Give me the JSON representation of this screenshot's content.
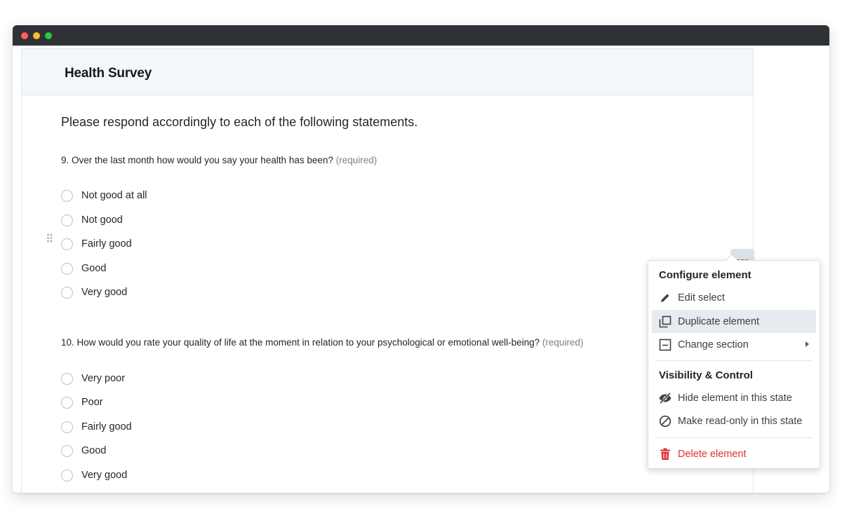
{
  "form": {
    "title": "Health Survey",
    "intro": "Please respond accordingly to each of the following statements."
  },
  "questions": [
    {
      "text": "9. Over the last month how would you say your health has been?",
      "required": "(required)",
      "options": [
        "Not good at all",
        "Not good",
        "Fairly good",
        "Good",
        "Very good"
      ]
    },
    {
      "text": "10. How would you rate your quality of life at the moment in relation to your psychological or emotional well-being?",
      "required": "(required)",
      "options": [
        "Very poor",
        "Poor",
        "Fairly good",
        "Good",
        "Very good"
      ]
    }
  ],
  "menu": {
    "configure_heading": "Configure element",
    "edit_select": "Edit select",
    "duplicate_element": "Duplicate element",
    "change_section": "Change section",
    "visibility_heading": "Visibility & Control",
    "hide_element": "Hide element in this state",
    "make_read_only": "Make read-only in this state",
    "delete_element": "Delete element"
  },
  "icons": {
    "more": "more-horizontal-icon",
    "drag": "drag-handle-icon",
    "edit": "pencil-icon",
    "duplicate": "duplicate-icon",
    "section": "section-icon",
    "hide": "eye-off-icon",
    "read_only": "block-icon",
    "delete": "trash-icon"
  },
  "colors": {
    "danger": "#d93232",
    "header_bg": "#f4f7fa",
    "titlebar": "#2e3236"
  }
}
